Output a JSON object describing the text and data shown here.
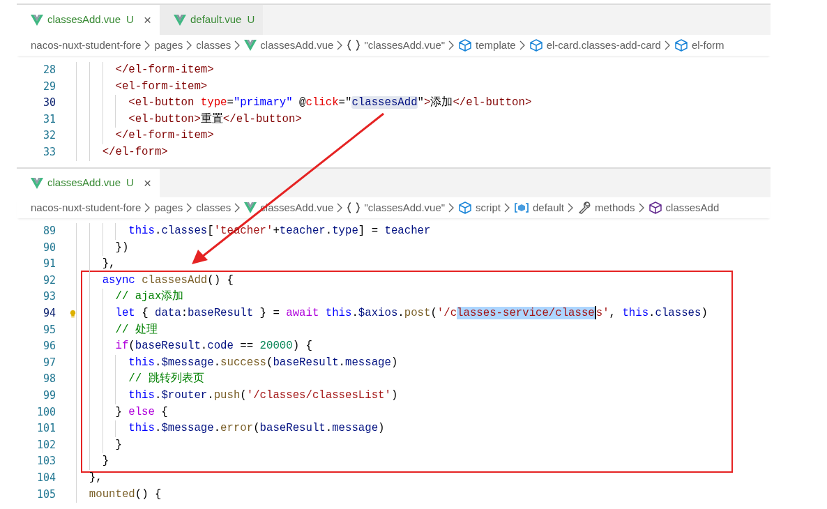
{
  "panes": [
    {
      "tabs": [
        {
          "label": "classesAdd.vue",
          "status": "U",
          "selected": true,
          "close": "×"
        },
        {
          "label": "default.vue",
          "status": "U",
          "selected": false
        }
      ],
      "breadcrumb": [
        {
          "label": "nacos-nuxt-student-fore",
          "kind": "folder"
        },
        {
          "label": "pages",
          "kind": "folder"
        },
        {
          "label": "classes",
          "kind": "folder"
        },
        {
          "label": "classesAdd.vue",
          "kind": "vue"
        },
        {
          "label": "\"classesAdd.vue\"",
          "kind": "object"
        },
        {
          "label": "template",
          "kind": "element"
        },
        {
          "label": "el-card.classes-add-card",
          "kind": "element"
        },
        {
          "label": "el-form",
          "kind": "element"
        }
      ],
      "lines": [
        {
          "number": "28",
          "current": false,
          "tokens": [
            {
              "text": "      </el-form-item>",
              "kind": "tag"
            }
          ]
        },
        {
          "number": "29",
          "current": false,
          "tokens": [
            {
              "text": "      <el-form-item>",
              "kind": "tag"
            }
          ]
        },
        {
          "number": "30",
          "current": true,
          "tokens": [
            {
              "text": "        <el-button",
              "kind": "tag"
            },
            {
              "text": " type",
              "kind": "attr"
            },
            {
              "text": "=",
              "kind": "plain"
            },
            {
              "text": "\"primary\"",
              "kind": "val"
            },
            {
              "text": " @",
              "kind": "plain"
            },
            {
              "text": "click",
              "kind": "attr"
            },
            {
              "text": "=\"",
              "kind": "plain"
            },
            {
              "text": "classesAdd",
              "kind": "var",
              "highlighted": true
            },
            {
              "text": "\"",
              "kind": "plain"
            },
            {
              "text": ">",
              "kind": "tag"
            },
            {
              "text": "添加",
              "kind": "plain"
            },
            {
              "text": "</el-button>",
              "kind": "tag"
            }
          ]
        },
        {
          "number": "31",
          "current": false,
          "tokens": [
            {
              "text": "        <el-button>",
              "kind": "tag"
            },
            {
              "text": "重置",
              "kind": "plain"
            },
            {
              "text": "</el-button>",
              "kind": "tag"
            }
          ]
        },
        {
          "number": "32",
          "current": false,
          "tokens": [
            {
              "text": "      </el-form-item>",
              "kind": "tag"
            }
          ]
        },
        {
          "number": "33",
          "current": false,
          "tokens": [
            {
              "text": "    </el-form>",
              "kind": "tag"
            }
          ]
        }
      ]
    },
    {
      "tabs": [
        {
          "label": "classesAdd.vue",
          "status": "U",
          "selected": true,
          "close": "×"
        }
      ],
      "breadcrumb": [
        {
          "label": "nacos-nuxt-student-fore",
          "kind": "folder"
        },
        {
          "label": "pages",
          "kind": "folder"
        },
        {
          "label": "classes",
          "kind": "folder"
        },
        {
          "label": "classesAdd.vue",
          "kind": "vue"
        },
        {
          "label": "\"classesAdd.vue\"",
          "kind": "object"
        },
        {
          "label": "script",
          "kind": "element"
        },
        {
          "label": "default",
          "kind": "module"
        },
        {
          "label": "methods",
          "kind": "wrench"
        },
        {
          "label": "classesAdd",
          "kind": "method"
        }
      ],
      "lines": [
        {
          "number": "89",
          "current": false,
          "tokens": [
            {
              "text": "        this",
              "kind": "kw"
            },
            {
              "text": ".",
              "kind": "plain"
            },
            {
              "text": "classes",
              "kind": "var"
            },
            {
              "text": "[",
              "kind": "plain"
            },
            {
              "text": "'teacher'",
              "kind": "str"
            },
            {
              "text": "+",
              "kind": "plain"
            },
            {
              "text": "teacher",
              "kind": "var"
            },
            {
              "text": ".",
              "kind": "plain"
            },
            {
              "text": "type",
              "kind": "var"
            },
            {
              "text": "] = ",
              "kind": "plain"
            },
            {
              "text": "teacher",
              "kind": "var"
            }
          ]
        },
        {
          "number": "90",
          "current": false,
          "tokens": [
            {
              "text": "      })",
              "kind": "plain"
            }
          ]
        },
        {
          "number": "91",
          "current": false,
          "tokens": [
            {
              "text": "    },",
              "kind": "plain"
            }
          ]
        },
        {
          "number": "92",
          "current": false,
          "tokens": [
            {
              "text": "    async",
              "kind": "kw"
            },
            {
              "text": " classesAdd",
              "kind": "fn"
            },
            {
              "text": "() {",
              "kind": "plain"
            }
          ]
        },
        {
          "number": "93",
          "current": false,
          "tokens": [
            {
              "text": "      // ajax添加",
              "kind": "cmt"
            }
          ]
        },
        {
          "number": "94",
          "current": true,
          "lightbulb": true,
          "tokens": [
            {
              "text": "      let",
              "kind": "kw"
            },
            {
              "text": " { ",
              "kind": "plain"
            },
            {
              "text": "data",
              "kind": "var"
            },
            {
              "text": ":",
              "kind": "plain"
            },
            {
              "text": "baseResult",
              "kind": "var"
            },
            {
              "text": " } = ",
              "kind": "plain"
            },
            {
              "text": "await",
              "kind": "ctl"
            },
            {
              "text": " this",
              "kind": "kw"
            },
            {
              "text": ".",
              "kind": "plain"
            },
            {
              "text": "$axios",
              "kind": "var"
            },
            {
              "text": ".",
              "kind": "plain"
            },
            {
              "text": "post",
              "kind": "fn"
            },
            {
              "text": "(",
              "kind": "plain"
            },
            {
              "text": "'/c",
              "kind": "str"
            },
            {
              "text": "lasses-service/classe",
              "kind": "str",
              "selected": true,
              "cursor": true
            },
            {
              "text": "s'",
              "kind": "str"
            },
            {
              "text": ", ",
              "kind": "plain"
            },
            {
              "text": "this",
              "kind": "kw"
            },
            {
              "text": ".",
              "kind": "plain"
            },
            {
              "text": "classes",
              "kind": "var"
            },
            {
              "text": ")",
              "kind": "plain"
            }
          ]
        },
        {
          "number": "95",
          "current": false,
          "tokens": [
            {
              "text": "      // 处理",
              "kind": "cmt"
            }
          ]
        },
        {
          "number": "96",
          "current": false,
          "tokens": [
            {
              "text": "      if",
              "kind": "ctl"
            },
            {
              "text": "(",
              "kind": "plain"
            },
            {
              "text": "baseResult",
              "kind": "var"
            },
            {
              "text": ".",
              "kind": "plain"
            },
            {
              "text": "code",
              "kind": "var"
            },
            {
              "text": " == ",
              "kind": "plain"
            },
            {
              "text": "20000",
              "kind": "num"
            },
            {
              "text": ") {",
              "kind": "plain"
            }
          ]
        },
        {
          "number": "97",
          "current": false,
          "tokens": [
            {
              "text": "        this",
              "kind": "kw"
            },
            {
              "text": ".",
              "kind": "plain"
            },
            {
              "text": "$message",
              "kind": "var"
            },
            {
              "text": ".",
              "kind": "plain"
            },
            {
              "text": "success",
              "kind": "fn"
            },
            {
              "text": "(",
              "kind": "plain"
            },
            {
              "text": "baseResult",
              "kind": "var"
            },
            {
              "text": ".",
              "kind": "plain"
            },
            {
              "text": "message",
              "kind": "var"
            },
            {
              "text": ")",
              "kind": "plain"
            }
          ]
        },
        {
          "number": "98",
          "current": false,
          "tokens": [
            {
              "text": "        // 跳转列表页",
              "kind": "cmt"
            }
          ]
        },
        {
          "number": "99",
          "current": false,
          "tokens": [
            {
              "text": "        this",
              "kind": "kw"
            },
            {
              "text": ".",
              "kind": "plain"
            },
            {
              "text": "$router",
              "kind": "var"
            },
            {
              "text": ".",
              "kind": "plain"
            },
            {
              "text": "push",
              "kind": "fn"
            },
            {
              "text": "(",
              "kind": "plain"
            },
            {
              "text": "'/classes/classesList'",
              "kind": "str"
            },
            {
              "text": ")",
              "kind": "plain"
            }
          ]
        },
        {
          "number": "100",
          "current": false,
          "tokens": [
            {
              "text": "      } ",
              "kind": "plain"
            },
            {
              "text": "else",
              "kind": "ctl"
            },
            {
              "text": " {",
              "kind": "plain"
            }
          ]
        },
        {
          "number": "101",
          "current": false,
          "tokens": [
            {
              "text": "        this",
              "kind": "kw"
            },
            {
              "text": ".",
              "kind": "plain"
            },
            {
              "text": "$message",
              "kind": "var"
            },
            {
              "text": ".",
              "kind": "plain"
            },
            {
              "text": "error",
              "kind": "fn"
            },
            {
              "text": "(",
              "kind": "plain"
            },
            {
              "text": "baseResult",
              "kind": "var"
            },
            {
              "text": ".",
              "kind": "plain"
            },
            {
              "text": "message",
              "kind": "var"
            },
            {
              "text": ")",
              "kind": "plain"
            }
          ]
        },
        {
          "number": "102",
          "current": false,
          "tokens": [
            {
              "text": "      }",
              "kind": "plain"
            }
          ]
        },
        {
          "number": "103",
          "current": false,
          "tokens": [
            {
              "text": "    }",
              "kind": "plain"
            }
          ]
        },
        {
          "number": "104",
          "current": false,
          "tokens": [
            {
              "text": "  },",
              "kind": "plain"
            }
          ]
        },
        {
          "number": "105",
          "current": false,
          "tokens": [
            {
              "text": "  mounted",
              "kind": "fn"
            },
            {
              "text": "() {",
              "kind": "plain"
            }
          ]
        }
      ]
    }
  ]
}
